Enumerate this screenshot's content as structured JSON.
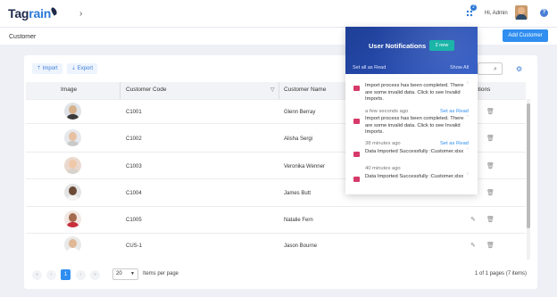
{
  "app": {
    "logo_part1": "Tag",
    "logo_part2": "rain"
  },
  "header": {
    "notif_count": "2",
    "greeting": "Hi, Admin",
    "help_glyph": "?"
  },
  "page": {
    "title": "Customer",
    "add_button": "Add Customer"
  },
  "toolbar": {
    "import_label": "Import",
    "export_label": "Export"
  },
  "table": {
    "headers": [
      "Image",
      "Customer Code",
      "Customer Name",
      "Actions"
    ],
    "rows": [
      {
        "code": "C1001",
        "name": "Glenn Berray"
      },
      {
        "code": "C1002",
        "name": "Alisha Sergi"
      },
      {
        "code": "C1003",
        "name": "Veronika Wenner"
      },
      {
        "code": "C1004",
        "name": "James Butt"
      },
      {
        "code": "C1005",
        "name": "Natalie Fern"
      },
      {
        "code": "CUS-1",
        "name": "Jason Bourne"
      }
    ]
  },
  "pager": {
    "current": "1",
    "page_size": "20",
    "items_label": "Items per page",
    "info": "1 of 1 pages (7 items)"
  },
  "notifications": {
    "title": "User Notifications",
    "new_badge": "2 new",
    "set_all": "Set all as Read",
    "show_all": "Show All",
    "items": [
      {
        "text": "Import process has been completed. There are some invalid data. Click to see Invalid Imports.",
        "time": "a few seconds ago",
        "action": "Set as Read"
      },
      {
        "text": "Import process has been completed. There are some invalid data. Click to see Invalid Imports.",
        "time": "38 minutes ago",
        "action": "Set as Read"
      },
      {
        "text": "Data Imported Successfully :Customer.xlsx",
        "time": "40 minutes ago",
        "action": ""
      },
      {
        "text": "Data Imported Successfully :Customer.xlsx",
        "time": "",
        "action": ""
      }
    ]
  },
  "colors": {
    "accent": "#2f8ef0",
    "brand_dark": "#1e2a4a",
    "notif_header": "#2b56c4",
    "notif_badge": "#1bb5a8",
    "notif_icon": "#d63a6a"
  }
}
